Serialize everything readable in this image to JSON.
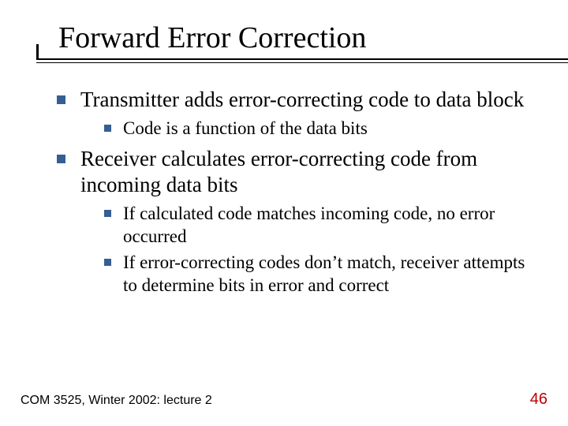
{
  "title": "Forward Error Correction",
  "bullets": [
    {
      "text": "Transmitter adds error-correcting code to data block",
      "children": [
        {
          "text": "Code is a function of the data bits"
        }
      ]
    },
    {
      "text": "Receiver calculates error-correcting code from incoming data bits",
      "children": [
        {
          "text": "If calculated code matches incoming code, no error occurred"
        },
        {
          "text": "If error-correcting codes don’t match, receiver attempts to determine bits in error and correct"
        }
      ]
    }
  ],
  "footer": {
    "left": "COM 3525, Winter 2002: lecture 2",
    "page": "46"
  }
}
